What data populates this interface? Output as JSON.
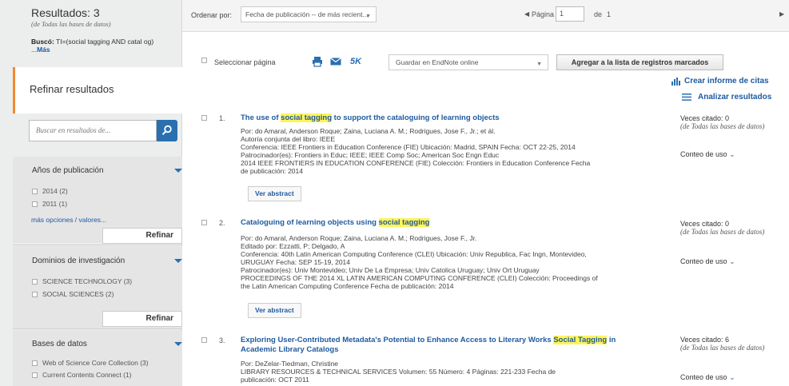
{
  "sidebar": {
    "results_title": "Resultados: 3",
    "results_source": "(de Todas las bases de datos)",
    "query_label": "Buscó:",
    "query_text": "TI=(social tagging AND catal og) ...",
    "query_more": "Más",
    "refine_title": "Refinar resultados",
    "search_placeholder": "Buscar en resultados de...",
    "sections": [
      {
        "title": "Años de publicación",
        "options": [
          "2014 (2)",
          "2011 (1)"
        ],
        "more": "más opciones / valores...",
        "button": "Refinar"
      },
      {
        "title": "Dominios de investigación",
        "options": [
          "SCIENCE TECHNOLOGY (3)",
          "SOCIAL SCIENCES (2)"
        ],
        "button": "Refinar"
      },
      {
        "title": "Bases de datos",
        "options": [
          "Web of Science Core Collection (3)",
          "Current Contents Connect (1)"
        ]
      }
    ]
  },
  "topbar": {
    "sort_label": "Ordenar por:",
    "sort_value": "Fecha de publicación -- de más recient...",
    "page_label": "Página",
    "page_value": "1",
    "page_of": "de",
    "page_total": "1"
  },
  "toolbar": {
    "select_page": "Seleccionar página",
    "fivek": "5K",
    "endnote": "Guardar en EndNote online",
    "add_marked": "Agregar a la lista de registros marcados"
  },
  "right_links": {
    "citation_report": "Crear informe de citas",
    "analyze": "Analizar resultados"
  },
  "records": [
    {
      "num": "1.",
      "title_pre": "The use of ",
      "title_hl": "social tagging",
      "title_post": " to support the cataloguing of learning objects",
      "lines": [
        "Por: do Amaral, Anderson Roque; Zaina, Luciana A. M.; Rodrigues, Jose F., Jr.; et ál.",
        "Autoría conjunta del libro: IEEE",
        "Conferencia: IEEE Frontiers in Education Conference (FIE) Ubicación: Madrid, SPAIN Fecha: OCT 22-25, 2014",
        "Patrocinador(es): Frontiers in Educ; IEEE; IEEE Comp Soc; American Soc Engn Educ",
        "2014 IEEE FRONTIERS IN EDUCATION CONFERENCE (FIE) Colección: Frontiers in Education Conference   Fecha",
        "de publicación: 2014"
      ],
      "abstract_btn": "Ver abstract",
      "cited": "Veces citado: 0",
      "cited_src": "(de Todas las bases de datos)",
      "usage": "Conteo de uso"
    },
    {
      "num": "2.",
      "title_pre": "Cataloguing of learning objects using ",
      "title_hl": "social tagging",
      "title_post": "",
      "lines": [
        "Por: do Amaral, Anderson Roque; Zaina, Luciana A. M.; Rodrigues, Jose F., Jr.",
        "Editado por: Ezzatti, P; Delgado, A",
        "Conferencia: 40th Latin American Computing Conference (CLEI) Ubicación: Univ Republica, Fac Ingn, Montevideo,",
        "URUGUAY Fecha: SEP 15-19, 2014",
        "Patrocinador(es): Univ Montevideo; Univ De La Empresa; Univ Catolica Uruguay; Univ Ort Uruguay",
        "PROCEEDINGS OF THE 2014 XL LATIN AMERICAN COMPUTING CONFERENCE (CLEI) Colección: Proceedings of",
        "the Latin American Computing Conference   Fecha de publicación: 2014"
      ],
      "abstract_btn": "Ver abstract",
      "cited": "Veces citado: 0",
      "cited_src": "(de Todas las bases de datos)",
      "usage": "Conteo de uso"
    },
    {
      "num": "3.",
      "title_pre": "Exploring User-Contributed Metadata's Potential to Enhance Access to Literary Works ",
      "title_hl": "Social Tagging",
      "title_post": " in Academic Library Catalogs",
      "lines": [
        "Por: DeZelar-Tiedman, Christine",
        "LIBRARY RESOURCES & TECHNICAL SERVICES  Volumen: 55  Número: 4  Páginas: 221-233  Fecha de",
        "publicación: OCT 2011"
      ],
      "cited": "Veces citado: 6",
      "cited_src": "(de Todas las bases de datos)",
      "usage": "Conteo de uso"
    }
  ]
}
